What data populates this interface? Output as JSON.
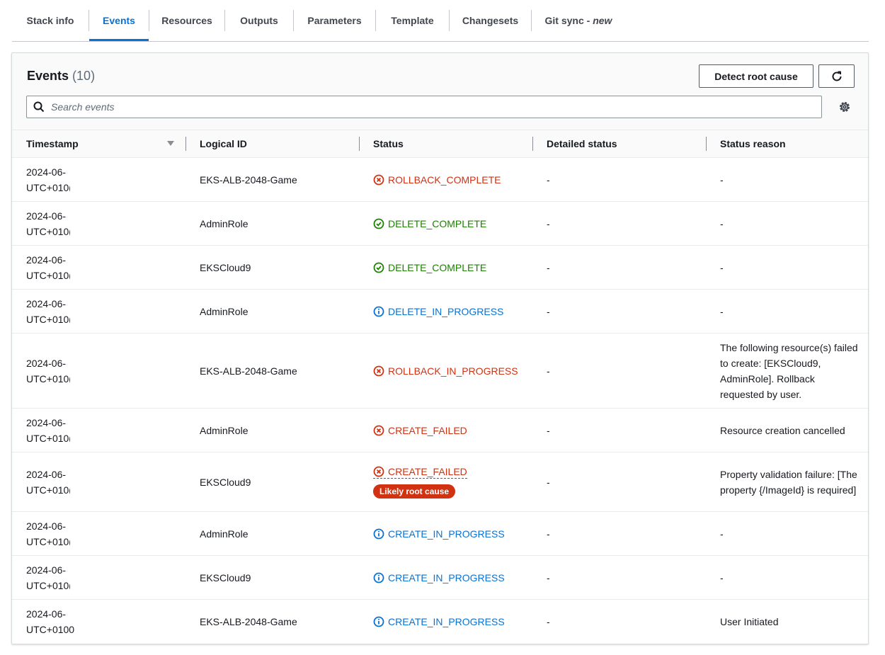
{
  "tabs": [
    {
      "label": "Stack info",
      "active": false
    },
    {
      "label": "Events",
      "active": true
    },
    {
      "label": "Resources",
      "active": false
    },
    {
      "label": "Outputs",
      "active": false
    },
    {
      "label": "Parameters",
      "active": false
    },
    {
      "label": "Template",
      "active": false
    },
    {
      "label": "Changesets",
      "active": false
    },
    {
      "label": "Git sync - ",
      "suffix": "new",
      "active": false
    }
  ],
  "events": {
    "title": "Events",
    "count": "(10)",
    "detect_root_cause_label": "Detect root cause",
    "refresh_icon": "refresh-icon",
    "search_placeholder": "Search events",
    "settings_icon": "gear-icon"
  },
  "table": {
    "columns": [
      "Timestamp",
      "Logical ID",
      "Status",
      "Detailed status",
      "Status reason"
    ],
    "rows": [
      {
        "ts1": "2024-06-",
        "ts2": "UTC+010(",
        "logical_id": "EKS-ALB-2048-Game",
        "status": "ROLLBACK_COMPLETE",
        "kind": "error",
        "detailed": "-",
        "reason": "-"
      },
      {
        "ts1": "2024-06-",
        "ts2": "UTC+010(",
        "logical_id": "AdminRole",
        "status": "DELETE_COMPLETE",
        "kind": "success",
        "detailed": "-",
        "reason": "-"
      },
      {
        "ts1": "2024-06-",
        "ts2": "UTC+010(",
        "logical_id": "EKSCloud9",
        "status": "DELETE_COMPLETE",
        "kind": "success",
        "detailed": "-",
        "reason": "-"
      },
      {
        "ts1": "2024-06-",
        "ts2": "UTC+010(",
        "logical_id": "AdminRole",
        "status": "DELETE_IN_PROGRESS",
        "kind": "info",
        "detailed": "-",
        "reason": "-"
      },
      {
        "ts1": "2024-06-",
        "ts2": "UTC+010(",
        "logical_id": "EKS-ALB-2048-Game",
        "status": "ROLLBACK_IN_PROGRESS",
        "kind": "error",
        "detailed": "-",
        "reason": "The following resource(s) failed to create: [EKSCloud9, AdminRole]. Rollback requested by user."
      },
      {
        "ts1": "2024-06-",
        "ts2": "UTC+010(",
        "logical_id": "AdminRole",
        "status": "CREATE_FAILED",
        "kind": "error",
        "detailed": "-",
        "reason": "Resource creation cancelled"
      },
      {
        "ts1": "2024-06-",
        "ts2": "UTC+010(",
        "logical_id": "EKSCloud9",
        "status": "CREATE_FAILED",
        "kind": "error",
        "badge": "Likely root cause",
        "detailed": "-",
        "reason": "Property validation failure: [The property {/ImageId} is required]"
      },
      {
        "ts1": "2024-06-",
        "ts2": "UTC+010(",
        "logical_id": "AdminRole",
        "status": "CREATE_IN_PROGRESS",
        "kind": "info",
        "detailed": "-",
        "reason": "-"
      },
      {
        "ts1": "2024-06-",
        "ts2": "UTC+010(",
        "logical_id": "EKSCloud9",
        "status": "CREATE_IN_PROGRESS",
        "kind": "info",
        "detailed": "-",
        "reason": "-"
      },
      {
        "ts1": "2024-06-",
        "ts2": "UTC+0100",
        "logical_id": "EKS-ALB-2048-Game",
        "status": "CREATE_IN_PROGRESS",
        "kind": "info",
        "detailed": "-",
        "reason": "User Initiated"
      }
    ]
  },
  "colors": {
    "error": "#d13212",
    "success": "#1d8102",
    "info": "#0972d3"
  }
}
